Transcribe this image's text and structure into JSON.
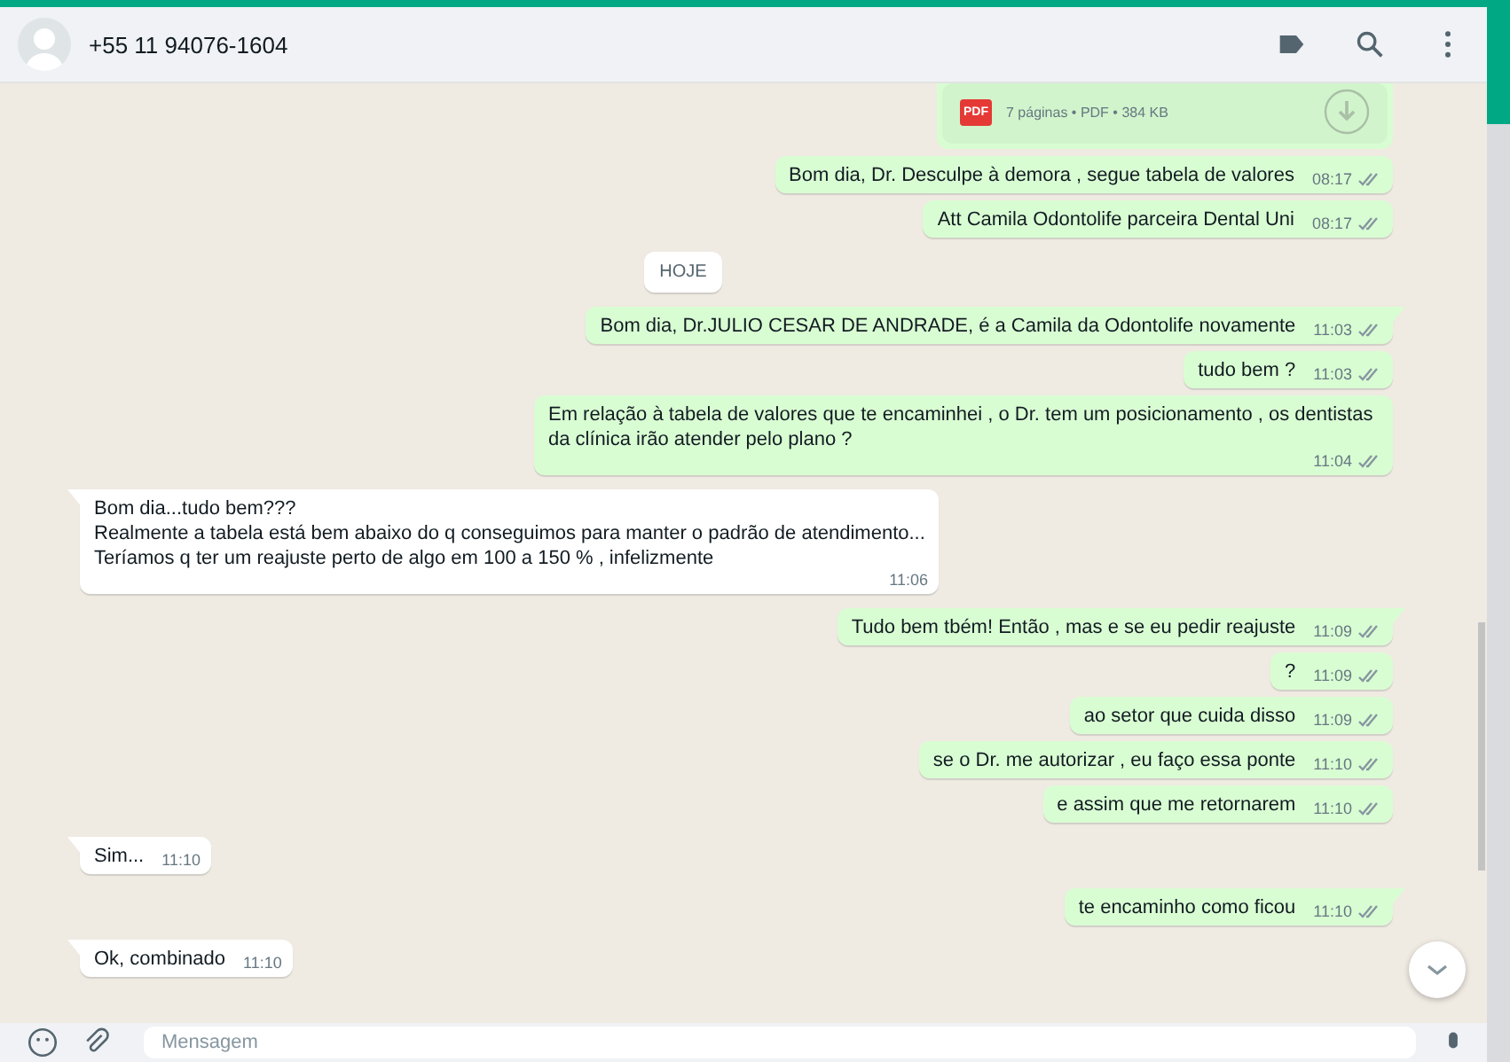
{
  "header": {
    "contact": "+55 11 94076-1604"
  },
  "messages": [
    {
      "kind": "document",
      "outgoing": true,
      "meta": "7 páginas • PDF • 384 KB",
      "badge": "PDF"
    },
    {
      "kind": "text",
      "outgoing": true,
      "text": "Bom dia, Dr. Desculpe à demora , segue tabela de valores",
      "time": "08:17",
      "read": false
    },
    {
      "kind": "text",
      "outgoing": true,
      "text": "Att Camila Odontolife parceira Dental Uni",
      "time": "08:17",
      "read": false
    },
    {
      "kind": "date",
      "text": "HOJE"
    },
    {
      "kind": "text",
      "outgoing": true,
      "text": "Bom dia, Dr.JULIO CESAR DE ANDRADE, é a Camila da Odontolife novamente",
      "time": "11:03",
      "read": false
    },
    {
      "kind": "text",
      "outgoing": true,
      "text": "tudo bem ?",
      "time": "11:03",
      "read": false
    },
    {
      "kind": "text",
      "outgoing": true,
      "text": "Em relação à tabela de valores que te encaminhei , o Dr. tem um posicionamento , os dentistas da clínica irão atender pelo plano ?",
      "time": "11:04",
      "read": false
    },
    {
      "kind": "text",
      "outgoing": false,
      "text": "Bom dia...tudo bem???\nRealmente a tabela está bem abaixo do q conseguimos para manter o padrão de atendimento...\nTeríamos q ter um reajuste perto de algo em 100 a 150 % , infelizmente",
      "time": "11:06"
    },
    {
      "kind": "text",
      "outgoing": true,
      "text": "Tudo bem tbém! Então , mas e se eu pedir reajuste",
      "time": "11:09",
      "read": false
    },
    {
      "kind": "text",
      "outgoing": true,
      "text": "?",
      "time": "11:09",
      "read": false
    },
    {
      "kind": "text",
      "outgoing": true,
      "text": "ao setor que cuida disso",
      "time": "11:09",
      "read": false
    },
    {
      "kind": "text",
      "outgoing": true,
      "text": "se o Dr. me autorizar , eu faço essa ponte",
      "time": "11:10",
      "read": false
    },
    {
      "kind": "text",
      "outgoing": true,
      "text": "e assim que me retornarem",
      "time": "11:10",
      "read": false
    },
    {
      "kind": "text",
      "outgoing": false,
      "text": "Sim...",
      "time": "11:10"
    },
    {
      "kind": "text",
      "outgoing": true,
      "text": "te encaminho como ficou",
      "time": "11:10",
      "read": false
    },
    {
      "kind": "text",
      "outgoing": false,
      "text": "Ok, combinado",
      "time": "11:10"
    }
  ],
  "composer": {
    "placeholder": "Mensagem"
  }
}
